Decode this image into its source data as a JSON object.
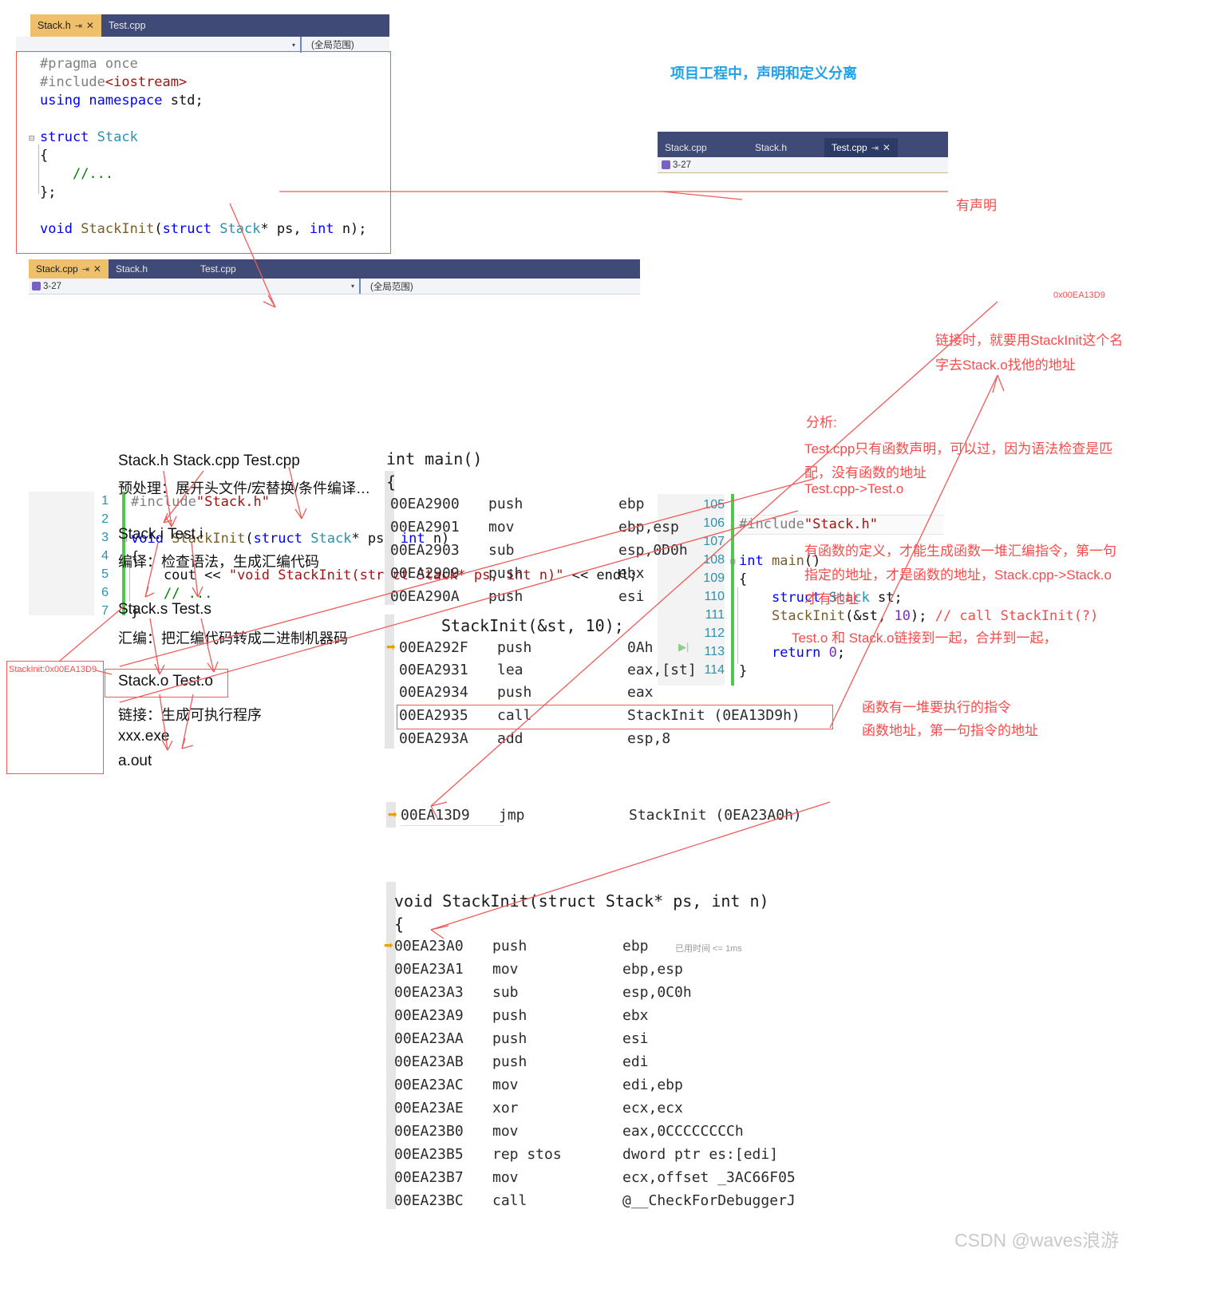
{
  "title_note": "项目工程中，声明和定义分离",
  "watermark": "CSDN @waves浪游",
  "editors": {
    "stack_h": {
      "tabs": [
        {
          "label": "Stack.h",
          "active": true,
          "pin": "⇥",
          "close": "✕"
        },
        {
          "label": "Test.cpp",
          "active": false
        }
      ],
      "scope": "(全局范围)",
      "nav_left": "",
      "lines": [
        "#pragma once",
        "#include<iostream>",
        "using namespace std;",
        "",
        "struct Stack",
        "{",
        "    //...",
        "};",
        "",
        "void StackInit(struct Stack* ps, int n);"
      ]
    },
    "stack_cpp": {
      "tabs": [
        {
          "label": "Stack.cpp",
          "active": true,
          "pin": "⇥",
          "close": "✕"
        },
        {
          "label": "Stack.h",
          "active": false
        },
        {
          "label": "Test.cpp",
          "active": false
        }
      ],
      "nav_left": "3-27",
      "scope": "(全局范围)",
      "line_numbers": [
        "1",
        "2",
        "3",
        "4",
        "5",
        "6",
        "7"
      ],
      "lines": [
        "#include\"Stack.h\"",
        "",
        "void StackInit(struct Stack* ps, int n)",
        "{",
        "    cout << \"void StackInit(struct Stack* ps, int n)\" << endl;",
        "    // ...",
        "}"
      ]
    },
    "test_cpp": {
      "tabs": [
        {
          "label": "Stack.cpp",
          "active": false
        },
        {
          "label": "Stack.h",
          "active": false
        },
        {
          "label": "Test.cpp",
          "active": true,
          "pin": "⇥",
          "close": "✕"
        }
      ],
      "nav_left": "3-27",
      "line_numbers": [
        "105",
        "106",
        "107",
        "108",
        "109",
        "110",
        "111",
        "112",
        "113",
        "114"
      ],
      "lines": [
        "",
        "#include\"Stack.h\"",
        "",
        "int main()",
        "{",
        "    struct Stack st;",
        "    StackInit(&st, 10); // call StackInit(?)",
        "",
        "    return 0;",
        "}"
      ],
      "inline_addr_note": "0x00EA13D9"
    }
  },
  "pipeline": {
    "row1_files": "Stack.h  Stack.cpp  Test.cpp",
    "row1_step": "预处理：展开头文件/宏替换/条件编译…",
    "row2_files": "Stack.i  Test.i",
    "row2_step": "编译：检查语法，生成汇编代码",
    "row3_files": "Stack.s Test.s",
    "row3_step": "汇编：把汇编代码转成二进制机器码",
    "row4_files": "Stack.o Test.o",
    "row4_step": "链接：生成可执行程序",
    "row5_a": "xxx.exe",
    "row5_b": "a.out",
    "symbol_box": "StackInit:0x00EA13D9"
  },
  "asm_main": {
    "header1": "int main()",
    "header2": "{",
    "rows": [
      {
        "addr": "00EA2900",
        "op": "push",
        "arg": "ebp"
      },
      {
        "addr": "00EA2901",
        "op": "mov",
        "arg": "ebp,esp"
      },
      {
        "addr": "00EA2903",
        "op": "sub",
        "arg": "esp,0D0h"
      },
      {
        "addr": "00EA2909",
        "op": "push",
        "arg": "ebx"
      },
      {
        "addr": "00EA290A",
        "op": "push",
        "arg": "esi"
      }
    ],
    "src_line": "StackInit(&st, 10);",
    "rows2": [
      {
        "addr": "00EA292F",
        "op": "push",
        "arg": "0Ah",
        "marker": true
      },
      {
        "addr": "00EA2931",
        "op": "lea",
        "arg": "eax,[st]"
      },
      {
        "addr": "00EA2934",
        "op": "push",
        "arg": "eax"
      },
      {
        "addr": "00EA2935",
        "op": "call",
        "arg": "StackInit (0EA13D9h)",
        "boxed": true
      },
      {
        "addr": "00EA293A",
        "op": "add",
        "arg": "esp,8"
      }
    ]
  },
  "asm_thunk": {
    "addr": "00EA13D9",
    "op": "jmp",
    "arg": "StackInit (0EA23A0h)"
  },
  "asm_stackinit": {
    "header1": "void StackInit(struct Stack* ps, int n)",
    "header2": "{",
    "timing": "已用时间 <= 1ms",
    "rows": [
      {
        "addr": "00EA23A0",
        "op": "push",
        "arg": "ebp",
        "marker": true
      },
      {
        "addr": "00EA23A1",
        "op": "mov",
        "arg": "ebp,esp"
      },
      {
        "addr": "00EA23A3",
        "op": "sub",
        "arg": "esp,0C0h"
      },
      {
        "addr": "00EA23A9",
        "op": "push",
        "arg": "ebx"
      },
      {
        "addr": "00EA23AA",
        "op": "push",
        "arg": "esi"
      },
      {
        "addr": "00EA23AB",
        "op": "push",
        "arg": "edi"
      },
      {
        "addr": "00EA23AC",
        "op": "mov",
        "arg": "edi,ebp"
      },
      {
        "addr": "00EA23AE",
        "op": "xor",
        "arg": "ecx,ecx"
      },
      {
        "addr": "00EA23B0",
        "op": "mov",
        "arg": "eax,0CCCCCCCCh"
      },
      {
        "addr": "00EA23B5",
        "op": "rep stos",
        "arg": "dword ptr es:[edi]"
      },
      {
        "addr": "00EA23B7",
        "op": "mov",
        "arg": "ecx,offset _3AC66F05"
      },
      {
        "addr": "00EA23BC",
        "op": "call",
        "arg": "@__CheckForDebuggerJ"
      }
    ]
  },
  "notes": {
    "has_decl": "有声明",
    "link_1": "链接时，就要用StackInit这个名",
    "link_2": "字去Stack.o找他的地址",
    "analysis_title": "分析:",
    "analysis_1": "Test.cpp只有函数声明，可以过，因为语法检查是匹",
    "analysis_2": "配，没有函数的地址",
    "analysis_3": "Test.cpp->Test.o",
    "def_1": "有函数的定义，才能生成函数一堆汇编指令，第一句",
    "def_2": "指定的地址，才是函数的地址，Stack.cpp->Stack.o",
    "def_3": "才有地址",
    "link_merge": "Test.o 和 Stack.o链接到一起，合并到一起，",
    "func_instr_1": "函数有一堆要执行的指令",
    "func_instr_2": "函数地址，第一句指令的地址"
  },
  "colors": {
    "annotation_red": "#fa4a4a",
    "title_blue": "#21a1e8",
    "tab_active": "#efc06b",
    "tabstrip": "#3f4a77"
  }
}
